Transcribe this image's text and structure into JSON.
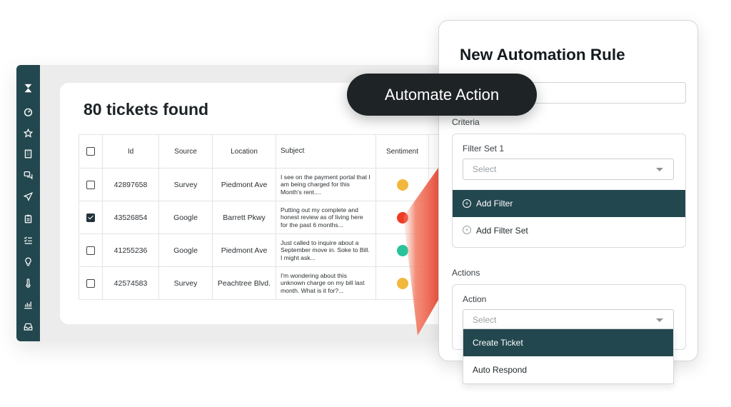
{
  "sidebar": {
    "icons": [
      "logo-icon",
      "dashboard-icon",
      "star-icon",
      "building-icon",
      "chat-icon",
      "send-icon",
      "clipboard-icon",
      "checklist-icon",
      "lightbulb-icon",
      "thermometer-icon",
      "bar-chart-icon",
      "inbox-icon"
    ]
  },
  "tickets": {
    "title": "80 tickets found",
    "columns": [
      "Id",
      "Source",
      "Location",
      "Subject",
      "Sentiment"
    ],
    "rows": [
      {
        "checked": false,
        "id": "42897658",
        "source": "Survey",
        "location": "Piedmont Ave",
        "subject": "I see on the payment portal that I am being charged for this Month's rent....",
        "sentiment_color": "#f2b83c"
      },
      {
        "checked": true,
        "id": "43526854",
        "source": "Google",
        "location": "Barrett Pkwy",
        "subject": "Putting out my complete and honest review as of living here for the past 6 months...",
        "sentiment_color": "#ee3b24"
      },
      {
        "checked": false,
        "id": "41255236",
        "source": "Google",
        "location": "Piedmont Ave",
        "subject": "Just called to inquire about a September move in. Soke to Bill. I might ask...",
        "sentiment_color": "#29c29b"
      },
      {
        "checked": false,
        "id": "42574583",
        "source": "Survey",
        "location": "Peachtree Blvd.",
        "subject": "I'm wondering about this unknown charge on my bill last month. What is it for?...",
        "sentiment_color": "#f2b83c"
      }
    ]
  },
  "pill": {
    "label": "Automate Action"
  },
  "rule": {
    "title": "New Automation Rule",
    "criteria_label": "Criteria",
    "filter_set_label": "Filter Set 1",
    "select_placeholder": "Select",
    "add_filter_label": "Add Filter",
    "add_filter_set_label": "Add Filter Set",
    "actions_label": "Actions",
    "action_label": "Action",
    "action_placeholder": "Select",
    "dropdown_options": [
      "Create Ticket",
      "Auto Respond"
    ]
  },
  "colors": {
    "sidebar": "#23474f",
    "accent_dark": "#23474f",
    "pill": "#1e2326",
    "beam": "#ee5a45"
  }
}
